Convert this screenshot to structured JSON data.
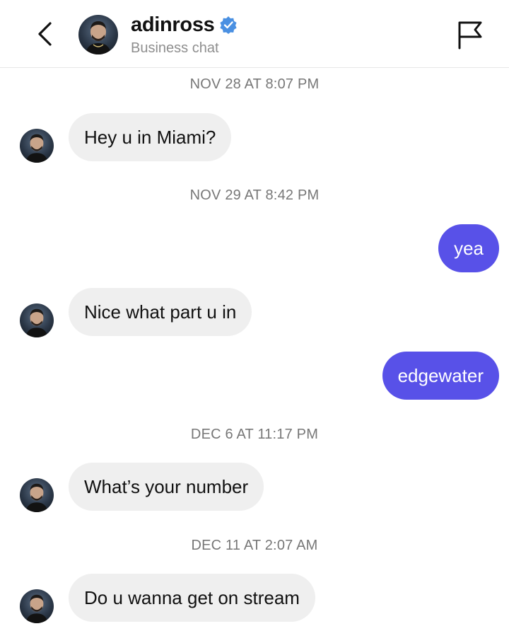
{
  "header": {
    "username": "adinross",
    "subtitle": "Business chat",
    "icons": {
      "back": "chevron-left-icon",
      "verified": "verified-badge-icon",
      "report": "flag-icon"
    },
    "verified_color": "#4a90e2"
  },
  "messages": [
    {
      "type": "timestamp",
      "text": "NOV 28 AT 8:07 PM"
    },
    {
      "type": "incoming",
      "text": "Hey u in Miami?"
    },
    {
      "type": "timestamp",
      "text": "NOV 29 AT 8:42 PM"
    },
    {
      "type": "outgoing",
      "text": "yea"
    },
    {
      "type": "incoming",
      "text": "Nice what part u in"
    },
    {
      "type": "outgoing",
      "text": "edgewater"
    },
    {
      "type": "timestamp",
      "text": "DEC 6 AT 11:17 PM"
    },
    {
      "type": "incoming",
      "text": "What’s your number"
    },
    {
      "type": "timestamp",
      "text": "DEC 11 AT 2:07 AM"
    },
    {
      "type": "incoming",
      "text": "Do u wanna get on stream"
    }
  ],
  "colors": {
    "incoming_bubble": "#efefef",
    "outgoing_bubble": "#5851e8",
    "timestamp": "#777777"
  }
}
